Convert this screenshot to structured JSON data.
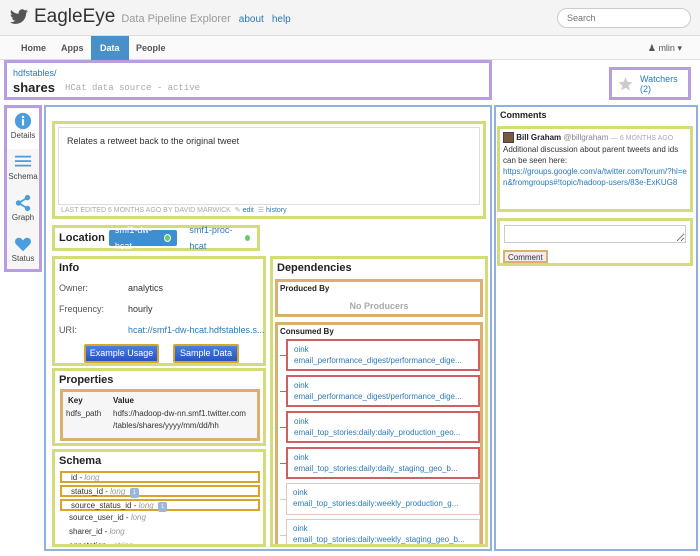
{
  "app": {
    "name": "EagleEye",
    "tagline": "Data Pipeline Explorer",
    "links": [
      "about",
      "help"
    ],
    "search_placeholder": "Search"
  },
  "nav": {
    "tabs": [
      "Home",
      "Apps",
      "Data",
      "People"
    ],
    "active_tab": "Data",
    "user": "mlin"
  },
  "header": {
    "breadcrumb": "hdfstables/",
    "title": "shares",
    "status": "HCat data source - active",
    "watchers_label": "Watchers (2)"
  },
  "rail": {
    "items": [
      {
        "label": "Details",
        "icon": "info-icon"
      },
      {
        "label": "Schema",
        "icon": "list-icon"
      },
      {
        "label": "Graph",
        "icon": "graph-icon"
      },
      {
        "label": "Status",
        "icon": "heart-icon"
      }
    ],
    "active": "Details"
  },
  "description": {
    "text": "Relates a retweet back to the original tweet",
    "meta": "LAST EDITED 6 MONTHS AGO BY DAVID MARWICK",
    "edit_label": "edit",
    "history_label": "history"
  },
  "location": {
    "label": "Location",
    "options": [
      {
        "name": "smf1-dw-hcat",
        "active": true
      },
      {
        "name": "smf1-proc-hcat",
        "active": false
      }
    ]
  },
  "info": {
    "title": "Info",
    "owner_label": "Owner:",
    "owner": "analytics",
    "frequency_label": "Frequency:",
    "frequency": "hourly",
    "uri_label": "URI:",
    "uri": "hcat://smf1-dw-hcat.hdfstables.s...",
    "example_button": "Example Usage",
    "sample_button": "Sample Data"
  },
  "properties": {
    "title": "Properties",
    "key_header": "Key",
    "value_header": "Value",
    "key": "hdfs_path",
    "value_line1": "hdfs://hadoop-dw-nn.smf1.twitter.com",
    "value_line2": "/tables/shares/yyyy/mm/dd/hh"
  },
  "schema": {
    "title": "Schema",
    "fields": [
      {
        "name": "id",
        "type": "long",
        "badge": ""
      },
      {
        "name": "status_id",
        "type": "long",
        "badge": "1"
      },
      {
        "name": "source_status_id",
        "type": "long",
        "badge": "1"
      },
      {
        "name": "source_user_id",
        "type": "long",
        "badge": ""
      },
      {
        "name": "sharer_id",
        "type": "long",
        "badge": ""
      },
      {
        "name": "annotation",
        "type": "string",
        "badge": ""
      }
    ]
  },
  "dependencies": {
    "title": "Dependencies",
    "produced_by_label": "Produced By",
    "no_producers": "No Producers",
    "consumed_by_label": "Consumed By",
    "consumers": [
      {
        "app": "oink",
        "job": "email_performance_digest/performance_dige..."
      },
      {
        "app": "oink",
        "job": "email_performance_digest/performance_dige..."
      },
      {
        "app": "oink",
        "job": "email_top_stories:daily:daily_production_geo..."
      },
      {
        "app": "oink",
        "job": "email_top_stories:daily:daily_staging_geo_b..."
      },
      {
        "app": "oink",
        "job": "email_top_stories:daily:weekly_production_g..."
      },
      {
        "app": "oink",
        "job": "email_top_stories:daily:weekly_staging_geo_b..."
      }
    ]
  },
  "comments": {
    "title": "Comments",
    "author": "Bill Graham",
    "handle": "@billgraham",
    "time": "6 MONTHS AGO",
    "text": "Additional discussion about parent tweets and ids can be seen here:",
    "link": "https://groups.google.com/a/twitter.com/forum/?hl=en&fromgroups#!topic/hadoop-users/83e-ExKUG8",
    "button": "Comment"
  },
  "colors": {
    "accent": "#4a90c8",
    "purple_box": "#b79ee0",
    "yellow_box": "#d4dc7a",
    "orange_box": "#d9b070",
    "red_box": "#d06060",
    "blue_frame": "#8fb0e0"
  }
}
